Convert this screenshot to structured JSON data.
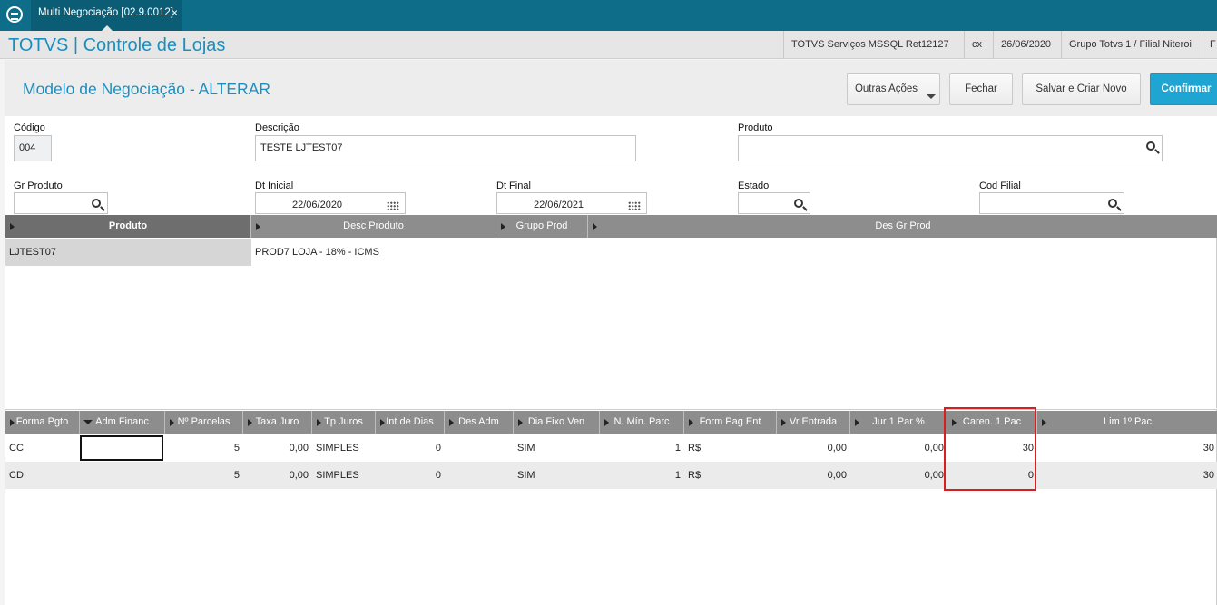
{
  "window": {
    "tab_label": "Multi Negociação [02.9.0012]",
    "tab_close": "×"
  },
  "appbar": {
    "title": "TOTVS | Controle de Lojas",
    "server": "TOTVS Serviços MSSQL Ret12127",
    "user": "cx",
    "date": "26/06/2020",
    "company": "Grupo Totvs 1 / Filial Niteroi",
    "extra": "F"
  },
  "page": {
    "title": "Modelo de Negociação - ALTERAR",
    "buttons": {
      "other_actions": "Outras Ações",
      "close": "Fechar",
      "save_new": "Salvar e Criar Novo",
      "confirm": "Confirmar"
    }
  },
  "form": {
    "codigo": {
      "label": "Código",
      "value": "004"
    },
    "descricao": {
      "label": "Descrição",
      "value": "TESTE LJTEST07"
    },
    "produto": {
      "label": "Produto",
      "value": ""
    },
    "gr_produto": {
      "label": "Gr Produto",
      "value": ""
    },
    "dt_inicial": {
      "label": "Dt Inicial",
      "value": "22/06/2020"
    },
    "dt_final": {
      "label": "Dt Final",
      "value": "22/06/2021"
    },
    "estado": {
      "label": "Estado",
      "value": ""
    },
    "cod_filial": {
      "label": "Cod Filial",
      "value": ""
    }
  },
  "products_grid": {
    "headers": [
      "Produto",
      "Desc Produto",
      "Grupo Prod",
      "Des Gr Prod"
    ],
    "rows": [
      [
        "LJTEST07",
        "PROD7 LOJA - 18% - ICMS",
        "",
        ""
      ]
    ]
  },
  "payments_grid": {
    "headers": [
      "Forma Pgto",
      "Adm Financ",
      "Nº Parcelas",
      "Taxa Juro",
      "Tp Juros",
      "Int de Dias",
      "Des Adm",
      "Dia Fixo Ven",
      "N. Mín. Parc",
      "Form Pag Ent",
      "Vr Entrada",
      "Jur 1 Par %",
      "Caren. 1 Pac",
      "Lim 1º Pac"
    ],
    "rows": [
      [
        "CC",
        "",
        "5",
        "0,00",
        "SIMPLES",
        "0",
        "",
        "SIM",
        "1",
        "R$",
        "0,00",
        "0,00",
        "30",
        "30"
      ],
      [
        "CD",
        "",
        "5",
        "0,00",
        "SIMPLES",
        "0",
        "",
        "SIM",
        "1",
        "R$",
        "0,00",
        "0,00",
        "0",
        "30"
      ]
    ]
  },
  "colors": {
    "topbar": "#0e6e8a",
    "accent": "#1a8fbf",
    "confirm": "#1ea5d2",
    "highlight_box": "#d62020"
  }
}
